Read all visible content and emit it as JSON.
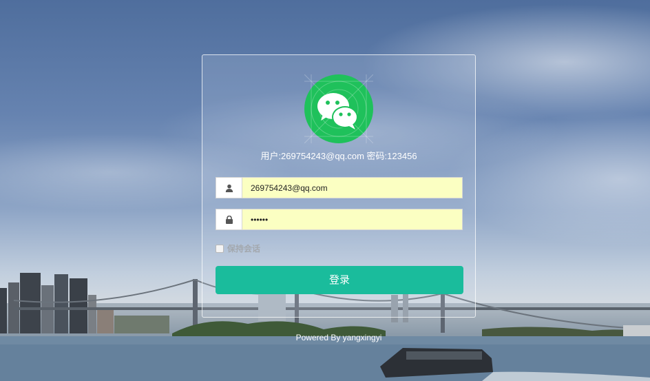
{
  "login": {
    "hint": "用户:269754243@qq.com 密码:123456",
    "username_value": "269754243@qq.com",
    "password_value": "123456",
    "remember_label": "保持会话",
    "remember_checked": false,
    "submit_label": "登录"
  },
  "footer": {
    "text": "Powered By yangxingyi"
  },
  "icons": {
    "logo": "wechat-logo",
    "username": "user-icon",
    "password": "lock-icon"
  },
  "colors": {
    "brand_green": "#1fc15b",
    "button": "#1abc9c",
    "autofill_bg": "#fbffc2"
  }
}
